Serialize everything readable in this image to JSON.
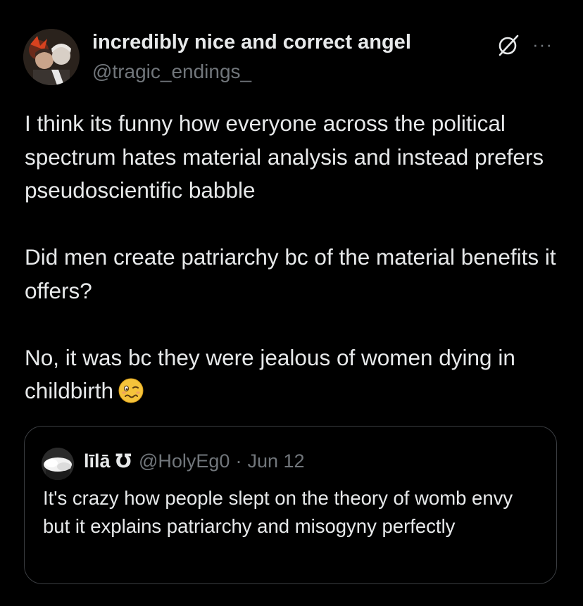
{
  "post": {
    "author": {
      "display_name": "incredibly nice and correct angel",
      "handle": "@tragic_endings_"
    },
    "icons": {
      "avatar": "profile-picture",
      "grok": "grok-icon",
      "more": "more-icon"
    },
    "more_label": "···",
    "paragraphs": [
      "I think its funny how everyone across the political spectrum hates material analysis and instead prefers pseudoscientific babble",
      "Did men create patriarchy bc of the material benefits it offers?",
      "No, it was bc they were jealous of women dying in childbirth"
    ],
    "emoji": "woozy-face-emoji"
  },
  "quote": {
    "author": {
      "display_name": "līlā ℧",
      "handle": "@HolyEg0"
    },
    "separator": "·",
    "date": "Jun 12",
    "text": "It's crazy how people slept on the theory of womb envy but it explains patriarchy and misogyny perfectly"
  },
  "colors": {
    "background": "#000000",
    "primary_text": "#e7e9ea",
    "secondary_text": "#71767b",
    "border": "#3a3d41"
  }
}
